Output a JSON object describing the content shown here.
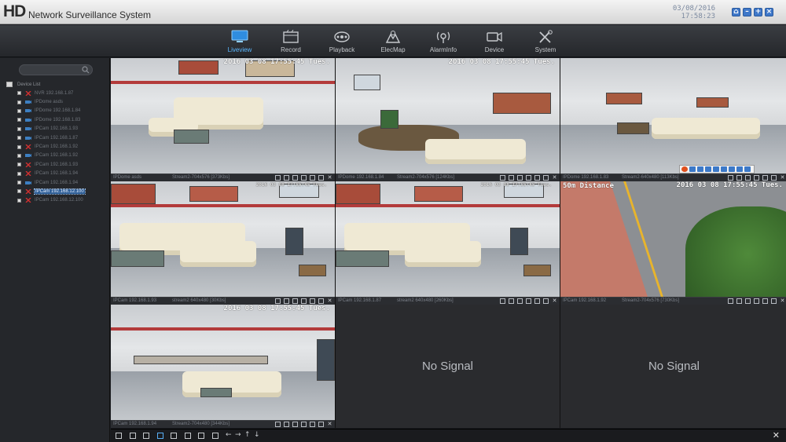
{
  "app": {
    "logo": "HD",
    "title": "Network Surveillance System",
    "date": "03/08/2016",
    "time": "17:58:23"
  },
  "nav": [
    {
      "label": "Liveview",
      "icon": "monitor-icon",
      "active": true
    },
    {
      "label": "Record",
      "icon": "film-icon"
    },
    {
      "label": "Playback",
      "icon": "reel-icon"
    },
    {
      "label": "ElecMap",
      "icon": "map-icon"
    },
    {
      "label": "AlarmInfo",
      "icon": "alarm-icon"
    },
    {
      "label": "Device",
      "icon": "camera-icon"
    },
    {
      "label": "System",
      "icon": "tools-icon"
    }
  ],
  "tree": {
    "root_label": "Device List",
    "items": [
      {
        "label": "NVR 192.168.1.87",
        "status": "offline"
      },
      {
        "label": "IPDome asds",
        "status": "online"
      },
      {
        "label": "IPDome 192.168.1.84",
        "status": "online"
      },
      {
        "label": "IPDome 192.168.1.83",
        "status": "online"
      },
      {
        "label": "IPCam 192.168.1.93",
        "status": "online"
      },
      {
        "label": "IPCam 192.168.1.87",
        "status": "online"
      },
      {
        "label": "IPCam 192.168.1.92",
        "status": "offline"
      },
      {
        "label": "IPCam 192.168.1.92",
        "status": "online"
      },
      {
        "label": "IPCam 192.168.1.93",
        "status": "offline"
      },
      {
        "label": "IPCam 192.168.1.94",
        "status": "offline"
      },
      {
        "label": "IPCam 192.168.1.94",
        "status": "online"
      },
      {
        "label": "IPCam 192.168.12.100",
        "status": "offline",
        "selected": true
      },
      {
        "label": "IPCam 192.168.12.100",
        "status": "offline"
      }
    ]
  },
  "tiles": [
    {
      "osd": "2016 03 08 17:55:45 Tues.",
      "camera": "IPDome asds",
      "stream": "Stream2-704x576 [373Kbs]",
      "scene": "lobby-near"
    },
    {
      "osd": "2016 03 08 17:55:45 Tues.",
      "camera": "IPDome 192.168.1.84",
      "stream": "Stream2-704x576 [124Kbs]",
      "scene": "lobby-table"
    },
    {
      "osd": "",
      "camera": "IPDome 192.168.1.83",
      "stream": "Stream2-640x480 [113Kbs]",
      "scene": "lobby-wide"
    },
    {
      "osd": "2016 03 08 17:55:45 Tues.",
      "camera": "IPCam 192.168.1.93",
      "stream": "stream2 640x480 [30Kbs]",
      "scene": "sofa",
      "small": true
    },
    {
      "osd": "2016 03 08 17:55:45 Tues.",
      "camera": "IPCam 192.168.1.87",
      "stream": "stream2 640x480 [260Kbs]",
      "scene": "sofa",
      "small": true
    },
    {
      "osd": "2016 03 08 17:55:45 Tues.",
      "osd_left": "50m Distance",
      "camera": "IPCam 192.168.1.92",
      "stream": "Stream2-704x576 [730Kbs]",
      "scene": "street",
      "selected": true
    },
    {
      "osd": "2016 03 08 17:55:45 Tues.",
      "camera": "IPCam 192.168.1.94",
      "stream": "Stream2-704x480 [344Kbs]",
      "scene": "lobby-far"
    },
    {
      "no_signal": "No Signal"
    },
    {
      "no_signal": "No Signal"
    }
  ],
  "bottom": {
    "layouts": [
      "1",
      "4",
      "6",
      "9",
      "12",
      "16",
      "25",
      "36"
    ],
    "active_layout": "9",
    "arrows": [
      "←",
      "→",
      "↑",
      "↓"
    ],
    "close": "✕"
  },
  "colors": {
    "accent": "#5bb8ff",
    "selected_border": "#c8202a",
    "offline": "#d23030",
    "online": "#3d7fc2"
  }
}
